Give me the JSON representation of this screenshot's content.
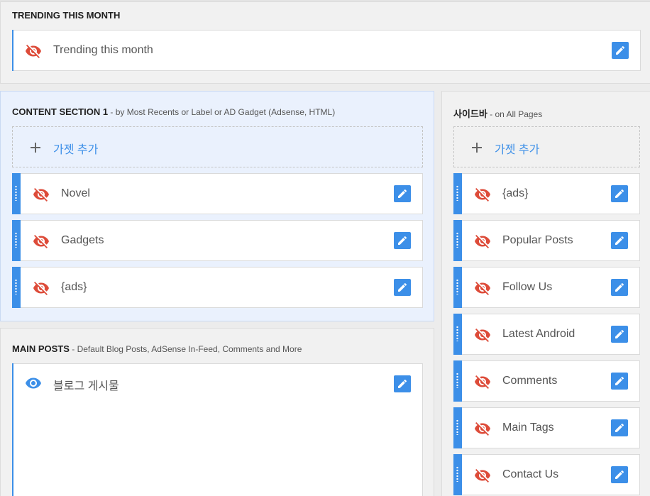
{
  "colors": {
    "accent": "#3c8fe8",
    "hidden_icon": "#dd4b39",
    "visible_icon": "#3c8fe8"
  },
  "trending": {
    "title": "TRENDING THIS MONTH",
    "widget": {
      "label": "Trending this month",
      "icon": "eye-off-icon"
    }
  },
  "content_section": {
    "title": "CONTENT SECTION 1",
    "subtitle": " - by Most Recents or Label or AD Gadget (Adsense, HTML)",
    "add_label": "가젯 추가",
    "widgets": [
      {
        "label": "Novel",
        "icon": "eye-off-icon"
      },
      {
        "label": "Gadgets",
        "icon": "eye-off-icon"
      },
      {
        "label": "{ads}",
        "icon": "eye-off-icon"
      }
    ]
  },
  "main_posts": {
    "title": "MAIN POSTS",
    "subtitle": " - Default Blog Posts, AdSense In-Feed, Comments and More",
    "widget": {
      "label": "블로그 게시물",
      "icon": "eye-icon"
    }
  },
  "sidebar": {
    "title": "사이드바",
    "subtitle": " - on All Pages",
    "add_label": "가젯 추가",
    "widgets": [
      {
        "label": "{ads}",
        "icon": "eye-off-icon"
      },
      {
        "label": "Popular Posts",
        "icon": "eye-off-icon"
      },
      {
        "label": "Follow Us",
        "icon": "eye-off-icon"
      },
      {
        "label": "Latest Android",
        "icon": "eye-off-icon"
      },
      {
        "label": "Comments",
        "icon": "eye-off-icon"
      },
      {
        "label": "Main Tags",
        "icon": "eye-off-icon"
      },
      {
        "label": "Contact Us",
        "icon": "eye-off-icon"
      }
    ]
  }
}
